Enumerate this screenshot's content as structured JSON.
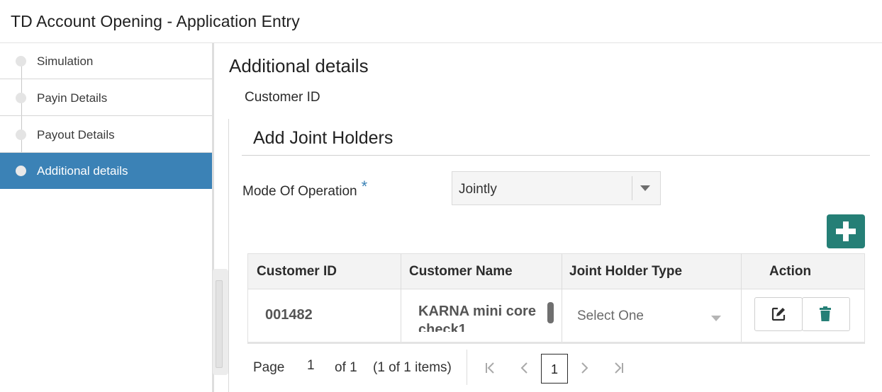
{
  "window": {
    "title": "TD Account Opening - Application Entry"
  },
  "sidebar": {
    "items": [
      {
        "label": "Simulation",
        "active": false
      },
      {
        "label": "Payin Details",
        "active": false
      },
      {
        "label": "Payout Details",
        "active": false
      },
      {
        "label": "Additional details",
        "active": true
      }
    ]
  },
  "main": {
    "section_title": "Additional details",
    "customer_id_label": "Customer ID",
    "panel_title": "Add Joint Holders",
    "mode_of_operation": {
      "label": "Mode Of Operation",
      "required_mark": "*",
      "value": "Jointly"
    },
    "add_button_icon": "plus-icon",
    "table": {
      "headers": [
        "Customer ID",
        "Customer Name",
        "Joint Holder Type",
        "Action"
      ],
      "rows": [
        {
          "customer_id": "001482",
          "customer_name": "KARNA mini core check1",
          "joint_holder_type_placeholder": "Select One",
          "actions": [
            "edit-icon",
            "trash-icon"
          ]
        }
      ]
    },
    "pager": {
      "page_label": "Page",
      "page_value": "1",
      "of_label": "of 1",
      "items_label": "(1 of 1 items)",
      "current_page": "1",
      "icons": [
        "first-page-icon",
        "prev-page-icon",
        "next-page-icon",
        "last-page-icon"
      ]
    }
  },
  "colors": {
    "accent": "#3b82b6",
    "add_button": "#257f76",
    "delete_icon": "#257f76"
  }
}
